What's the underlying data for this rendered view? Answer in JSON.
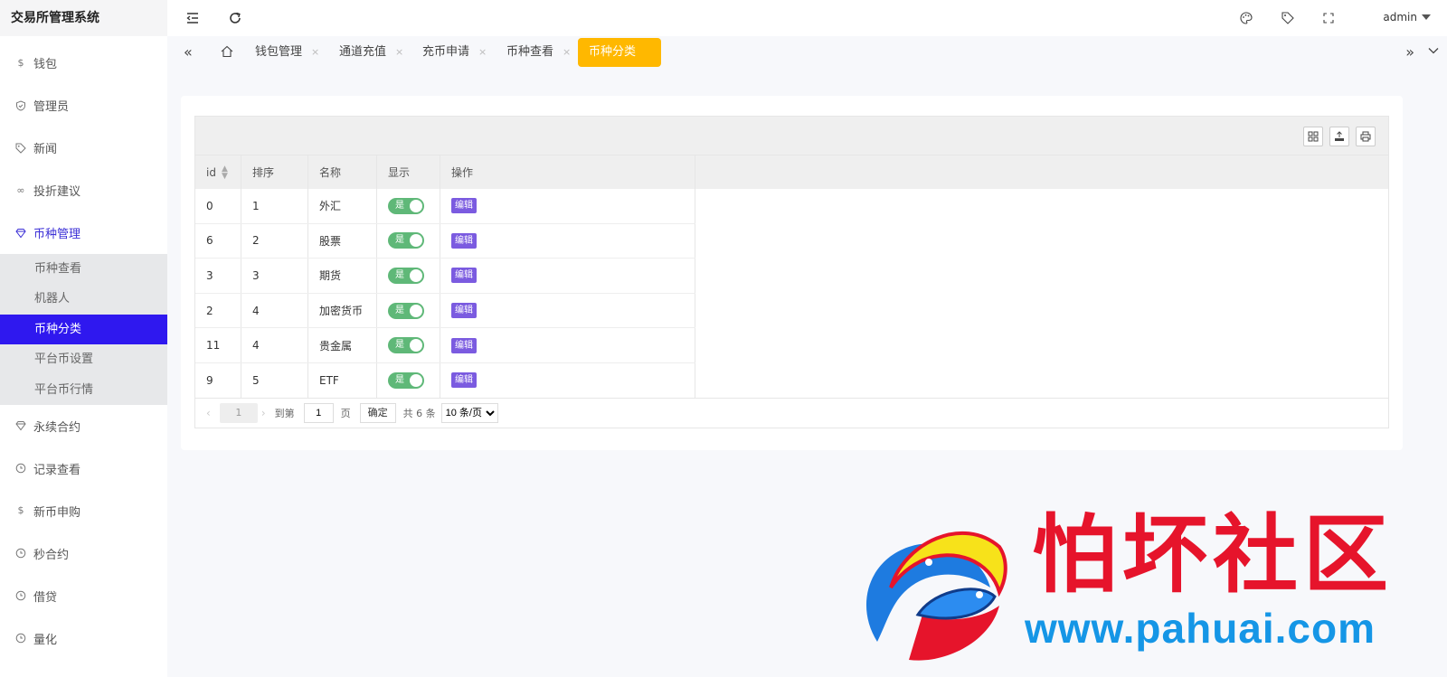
{
  "app": {
    "title": "交易所管理系统"
  },
  "sidebar": {
    "items": [
      {
        "label": "钱包",
        "icon": "dollar-icon"
      },
      {
        "label": "管理员",
        "icon": "shield-icon"
      },
      {
        "label": "新闻",
        "icon": "tag-icon"
      },
      {
        "label": "投折建议",
        "icon": "link-icon"
      },
      {
        "label": "币种管理",
        "icon": "diamond-icon"
      }
    ],
    "submenu": [
      {
        "label": "币种查看"
      },
      {
        "label": "机器人"
      },
      {
        "label": "币种分类"
      },
      {
        "label": "平台币设置"
      },
      {
        "label": "平台币行情"
      }
    ],
    "items_after": [
      {
        "label": "永续合约",
        "icon": "diamond-icon"
      },
      {
        "label": "记录查看",
        "icon": "clock-icon"
      },
      {
        "label": "新币申购",
        "icon": "dollar-icon"
      },
      {
        "label": "秒合约",
        "icon": "clock-icon"
      },
      {
        "label": "借贷",
        "icon": "clock-icon"
      },
      {
        "label": "量化",
        "icon": "clock-icon"
      }
    ]
  },
  "topbar": {
    "user": "admin",
    "icons": [
      "menu-fold-icon",
      "refresh-icon",
      "palette-icon",
      "tag-icon",
      "fullscreen-icon"
    ]
  },
  "tabs": {
    "items": [
      {
        "label": "钱包管理"
      },
      {
        "label": "通道充值"
      },
      {
        "label": "充币申请"
      },
      {
        "label": "币种查看"
      },
      {
        "label": "币种分类"
      }
    ],
    "close_glyph": "×"
  },
  "table": {
    "columns": [
      "id",
      "排序",
      "名称",
      "显示",
      "操作"
    ],
    "rows": [
      {
        "id": "0",
        "sort": "1",
        "name": "外汇",
        "show": "是",
        "op": "编辑"
      },
      {
        "id": "6",
        "sort": "2",
        "name": "股票",
        "show": "是",
        "op": "编辑"
      },
      {
        "id": "3",
        "sort": "3",
        "name": "期货",
        "show": "是",
        "op": "编辑"
      },
      {
        "id": "2",
        "sort": "4",
        "name": "加密货币",
        "show": "是",
        "op": "编辑"
      },
      {
        "id": "11",
        "sort": "4",
        "name": "贵金属",
        "show": "是",
        "op": "编辑"
      },
      {
        "id": "9",
        "sort": "5",
        "name": "ETF",
        "show": "是",
        "op": "编辑"
      }
    ],
    "toolbar_icons": [
      "columns-icon",
      "export-icon",
      "print-icon"
    ]
  },
  "pager": {
    "current": "1",
    "goto_label": "到第",
    "goto_value": "1",
    "page_label": "页",
    "ok_label": "确定",
    "total_label": "共 6 条",
    "page_size": "10 条/页"
  },
  "watermark": {
    "title": "怕坏社区",
    "url": "www.pahuai.com"
  },
  "colors": {
    "accent": "#2f18ef",
    "active_tab": "#ffb800",
    "switch_on": "#5fb878",
    "edit_button": "#7b5be0",
    "watermark_red": "#e6142b",
    "watermark_blue": "#1596e6"
  }
}
